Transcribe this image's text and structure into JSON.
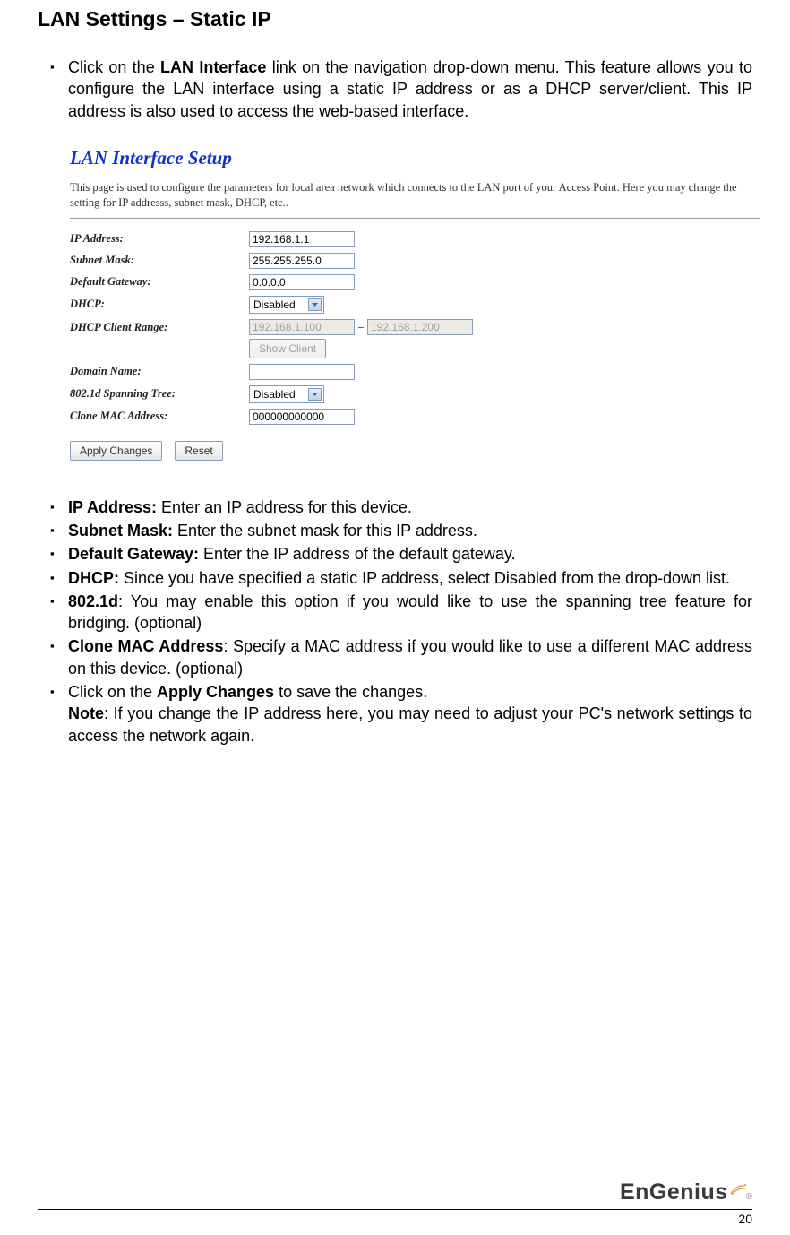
{
  "title": "LAN Settings – Static IP",
  "intro_pre": "Click on the ",
  "intro_bold": "LAN Interface",
  "intro_post": " link on the navigation drop-down menu. This feature allows you to configure the LAN interface using a static IP address or as a DHCP server/client.  This IP address is also used to access the web-based interface.",
  "shot": {
    "title": "LAN Interface Setup",
    "desc": "This page is used to configure the parameters for local area network which connects to the LAN port of your Access Point. Here you may change the setting for IP addresss, subnet mask, DHCP, etc..",
    "labels": {
      "ip": "IP Address:",
      "subnet": "Subnet Mask:",
      "gw": "Default Gateway:",
      "dhcp": "DHCP:",
      "range": "DHCP Client Range:",
      "domain": "Domain Name:",
      "stp": "802.1d Spanning Tree:",
      "clone": "Clone MAC Address:"
    },
    "values": {
      "ip": "192.168.1.1",
      "subnet": "255.255.255.0",
      "gw": "0.0.0.0",
      "dhcp": "Disabled",
      "range_start": "192.168.1.100",
      "range_end": "192.168.1.200",
      "show_client": "Show Client",
      "domain": "",
      "stp": "Disabled",
      "clone": "000000000000"
    },
    "buttons": {
      "apply": "Apply Changes",
      "reset": "Reset"
    }
  },
  "list": {
    "ip_b": "IP Address:",
    "ip_t": " Enter an IP address for this device.",
    "sub_b": "Subnet Mask:",
    "sub_t": " Enter the subnet mask for this IP address.",
    "gw_b": "Default Gateway:",
    "gw_t": " Enter the IP address of the default gateway.",
    "dhcp_b": "DHCP:",
    "dhcp_t": " Since you have specified a static IP address, select Disabled from the drop-down list.",
    "stp_b": "802.1d",
    "stp_t": ": You may enable this option if you would like to use the spanning tree feature for bridging. (optional)",
    "clone_b": "Clone MAC Address",
    "clone_t": ": Specify a MAC address if you would like to use a different MAC address on this device. (optional)",
    "apply_pre": "Click on the ",
    "apply_b": "Apply Changes",
    "apply_post": " to save the changes.",
    "note_b": "Note",
    "note_t": ": If you change the IP address here, you  may need to adjust your PC's network settings to access the network again."
  },
  "footer": {
    "brand": "EnGenius",
    "page": "20"
  }
}
